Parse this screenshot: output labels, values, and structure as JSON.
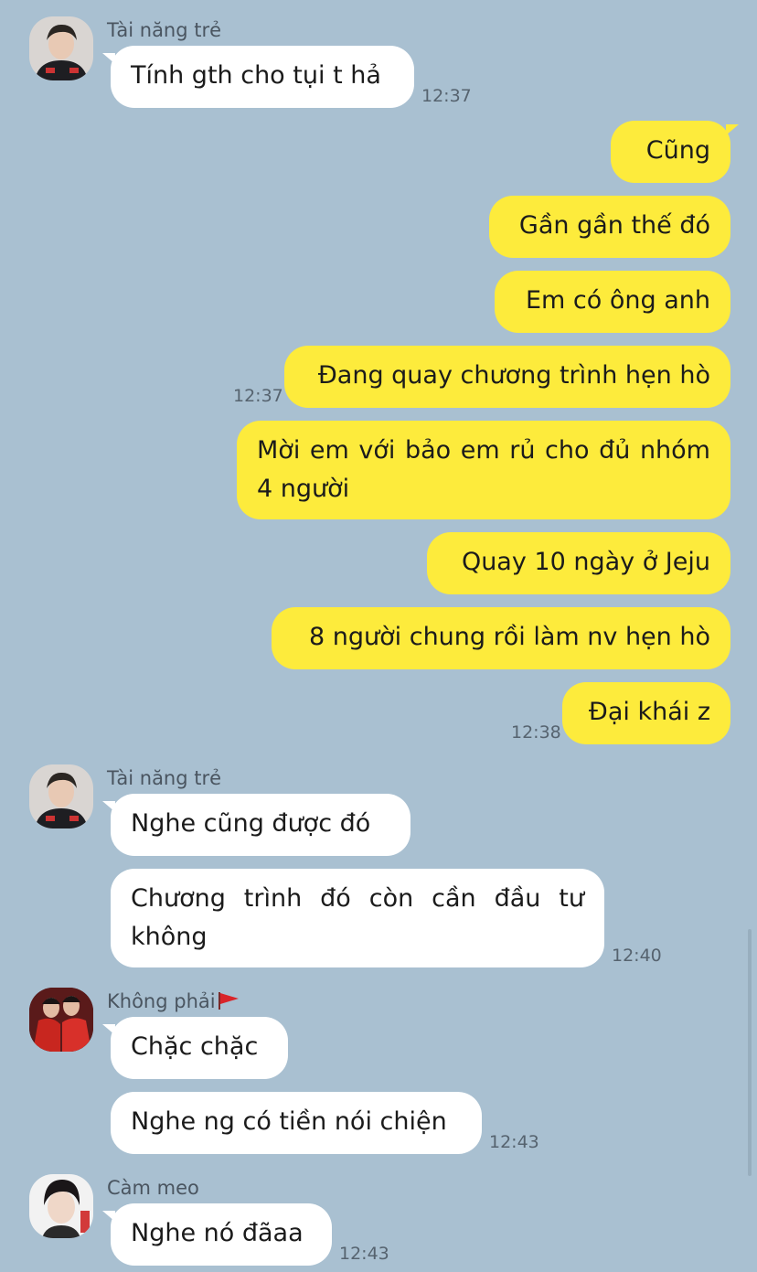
{
  "messages": [
    {
      "sender": "Tài năng trẻ",
      "text": "Tính gth cho tụi t hả",
      "time": "12:37"
    },
    {
      "text": "Cũng"
    },
    {
      "text": "Gần gần thế đó"
    },
    {
      "text": "Em có ông anh"
    },
    {
      "text": "Đang quay chương trình hẹn hò",
      "time": "12:37"
    },
    {
      "text": "Mời em với bảo em rủ cho đủ nhóm 4 người"
    },
    {
      "text": "Quay 10 ngày ở Jeju"
    },
    {
      "text": "8 người chung rồi làm nv hẹn hò"
    },
    {
      "text": "Đại khái z",
      "time": "12:38"
    },
    {
      "sender": "Tài năng trẻ",
      "text": "Nghe cũng được đó"
    },
    {
      "text": "Chương trình đó còn cần đầu tư không",
      "time": "12:40"
    },
    {
      "sender": "Không phải",
      "text": "Chặc chặc"
    },
    {
      "text": "Nghe ng có tiền nói chiện",
      "time": "12:43"
    },
    {
      "sender": "Càm meo",
      "text": "Nghe nó đãaa",
      "time": "12:43"
    }
  ],
  "icons": {
    "sender_flag": "red-flag-icon",
    "avatar_1": "avatar-photo",
    "avatar_2": "avatar-photo",
    "avatar_3": "avatar-photo",
    "avatar_4": "avatar-photo"
  },
  "colors": {
    "background": "#a9c0d1",
    "outgoing_bubble": "#fdeb3c",
    "incoming_bubble": "#ffffff",
    "flag": "#d9252a"
  }
}
